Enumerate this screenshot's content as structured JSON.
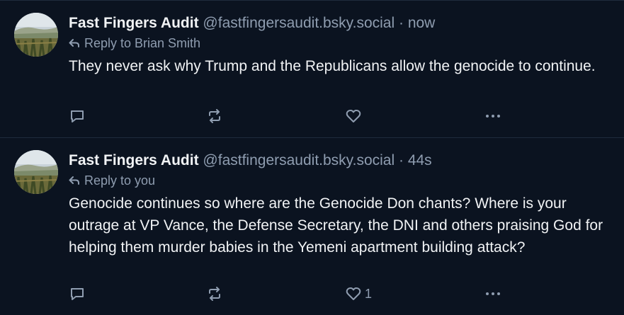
{
  "posts": [
    {
      "display_name": "Fast Fingers Audit",
      "handle": "@fastfingersaudit.bsky.social",
      "separator": "·",
      "timestamp": "now",
      "reply_to": "Reply to Brian Smith",
      "text": "They never ask why Trump and the Republicans allow the genocide to continue.",
      "like_count": ""
    },
    {
      "display_name": "Fast Fingers Audit",
      "handle": "@fastfingersaudit.bsky.social",
      "separator": "·",
      "timestamp": "44s",
      "reply_to": "Reply to you",
      "text": "Genocide continues so where are the Genocide Don chants? Where is your outrage at VP Vance, the Defense Secretary, the DNI and others praising God for helping them murder babies in the Yemeni apartment building attack?",
      "like_count": "1"
    }
  ],
  "icons": {
    "reply": "speech-bubble-icon",
    "repost": "repost-arrows-icon",
    "like": "heart-icon",
    "more": "ellipsis-icon",
    "reply_arrow": "reply-arrow-icon"
  },
  "colors": {
    "background": "#0b1320",
    "text": "#f1f3f5",
    "muted": "#8f9db0",
    "divider": "#1f2b3d"
  }
}
